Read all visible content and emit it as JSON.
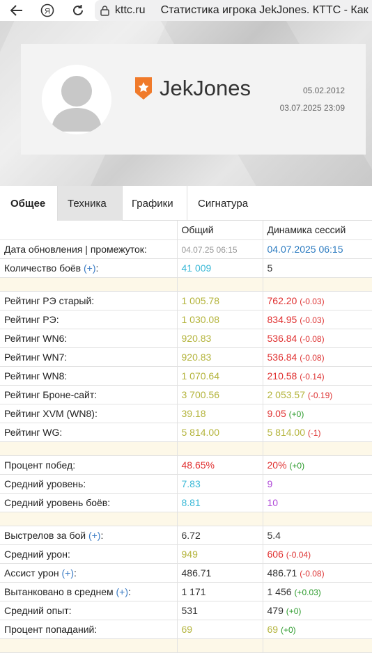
{
  "browser": {
    "domain": "kttc.ru",
    "page_title": "Статистика игрока JekJones. КТТС - Как"
  },
  "profile": {
    "nickname": "JekJones",
    "reg_date": "05.02.2012",
    "last_battle": "03.07.2025 23:09"
  },
  "tabs": [
    "Общее",
    "Техника",
    "Графики",
    "Сигнатура"
  ],
  "colors": {
    "cyan": "#3ab8d6",
    "olive": "#b4b43c",
    "red": "#e03030",
    "purple": "#b04ad8",
    "blue": "#2a7ac0",
    "gray": "#999999",
    "dark": "#333333"
  },
  "table": {
    "headers": [
      "",
      "Общий",
      "Динамика сессий"
    ],
    "rows": [
      {
        "label": "Дата обновления | промежуток:",
        "plus": "",
        "v1": "04.07.25 06:15",
        "c1": "gray",
        "s1": "small",
        "v2": "04.07.2025 06:15",
        "c2": "blue",
        "d2": "",
        "dc": ""
      },
      {
        "label": "Количество боёв ",
        "plus": "(+)",
        "tail": ":",
        "v1": "41 009",
        "c1": "cyan",
        "v2": "5",
        "c2": "dark",
        "d2": "",
        "dc": ""
      },
      {
        "gap": true
      },
      {
        "label": "Рейтинг РЭ старый:",
        "v1": "1 005.78",
        "c1": "olive",
        "v2": "762.20",
        "c2": "red",
        "d2": "(-0.03)",
        "dc": "neg"
      },
      {
        "label": "Рейтинг РЭ:",
        "v1": "1 030.08",
        "c1": "olive",
        "v2": "834.95",
        "c2": "red",
        "d2": "(-0.03)",
        "dc": "neg"
      },
      {
        "label": "Рейтинг WN6:",
        "v1": "920.83",
        "c1": "olive",
        "v2": "536.84",
        "c2": "red",
        "d2": "(-0.08)",
        "dc": "neg"
      },
      {
        "label": "Рейтинг WN7:",
        "v1": "920.83",
        "c1": "olive",
        "v2": "536.84",
        "c2": "red",
        "d2": "(-0.08)",
        "dc": "neg"
      },
      {
        "label": "Рейтинг WN8:",
        "v1": "1 070.64",
        "c1": "olive",
        "v2": "210.58",
        "c2": "red",
        "d2": "(-0.14)",
        "dc": "neg"
      },
      {
        "label": "Рейтинг Броне-сайт:",
        "v1": "3 700.56",
        "c1": "olive",
        "v2": "2 053.57",
        "c2": "olive",
        "d2": "(-0.19)",
        "dc": "neg"
      },
      {
        "label": "Рейтинг XVM (WN8):",
        "v1": "39.18",
        "c1": "olive",
        "v2": "9.05",
        "c2": "red",
        "d2": "(+0)",
        "dc": "pos"
      },
      {
        "label": "Рейтинг WG:",
        "v1": "5 814.00",
        "c1": "olive",
        "v2": "5 814.00",
        "c2": "olive",
        "d2": "(-1)",
        "dc": "neg"
      },
      {
        "gap": true
      },
      {
        "label": "Процент побед:",
        "v1": "48.65%",
        "c1": "red",
        "v2": "20%",
        "c2": "red",
        "d2": "(+0)",
        "dc": "pos"
      },
      {
        "label": "Средний уровень:",
        "v1": "7.83",
        "c1": "cyan",
        "v2": "9",
        "c2": "purple",
        "d2": "",
        "dc": ""
      },
      {
        "label": "Средний уровень боёв:",
        "v1": "8.81",
        "c1": "cyan",
        "v2": "10",
        "c2": "purple",
        "d2": "",
        "dc": ""
      },
      {
        "gap": true
      },
      {
        "label": "Выстрелов за бой ",
        "plus": "(+)",
        "tail": ":",
        "v1": "6.72",
        "c1": "dark",
        "v2": "5.4",
        "c2": "dark",
        "d2": "",
        "dc": ""
      },
      {
        "label": "Средний урон:",
        "v1": "949",
        "c1": "olive",
        "v2": "606",
        "c2": "red",
        "d2": "(-0.04)",
        "dc": "neg"
      },
      {
        "label": "Ассист урон ",
        "plus": "(+)",
        "tail": ":",
        "v1": "486.71",
        "c1": "dark",
        "v2": "486.71",
        "c2": "dark",
        "d2": "(-0.08)",
        "dc": "neg"
      },
      {
        "label": "Вытанковано в среднем ",
        "plus": "(+)",
        "tail": ":",
        "v1": "1 171",
        "c1": "dark",
        "v2": "1 456",
        "c2": "dark",
        "d2": "(+0.03)",
        "dc": "pos"
      },
      {
        "label": "Средний опыт:",
        "v1": "531",
        "c1": "dark",
        "v2": "479",
        "c2": "dark",
        "d2": "(+0)",
        "dc": "pos"
      },
      {
        "label": "Процент попаданий:",
        "v1": "69",
        "c1": "olive",
        "v2": "69",
        "c2": "olive",
        "d2": "(+0)",
        "dc": "pos"
      },
      {
        "gap": true
      }
    ]
  }
}
